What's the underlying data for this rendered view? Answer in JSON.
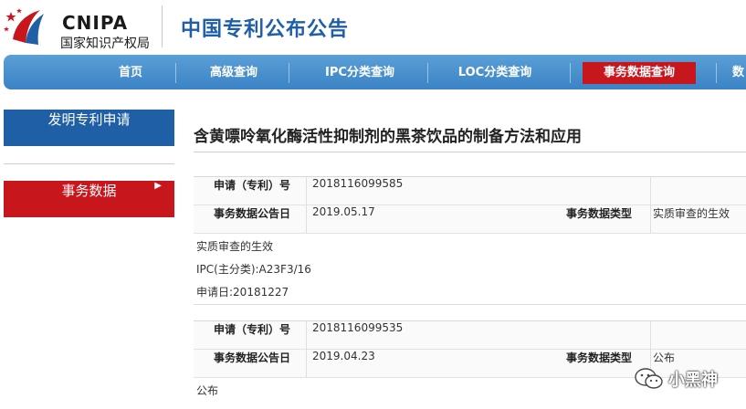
{
  "header": {
    "logo_en": "CNIPA",
    "logo_cn": "国家知识产权局",
    "site_title": "中国专利公布公告"
  },
  "nav": {
    "items": [
      "首页",
      "高级查询",
      "IPC分类查询",
      "LOC分类查询",
      "事务数据查询",
      "数"
    ],
    "active_index": 4
  },
  "sidebar": {
    "items": [
      {
        "label": "发明专利申请"
      },
      {
        "label": "事务数据",
        "arrow": "▶"
      }
    ]
  },
  "main": {
    "title": "含黄嘌呤氧化酶活性抑制剂的黑茶饮品的制备方法和应用"
  },
  "records": [
    {
      "app_no_label": "申请（专利）号",
      "app_no": "2018116099585",
      "date_label": "事务数据公告日",
      "date": "2019.05.17",
      "type_label": "事务数据类型",
      "type": "实质审查的生效",
      "details": [
        "实质审查的生效",
        "IPC(主分类):A23F3/16",
        "申请日:20181227"
      ]
    },
    {
      "app_no_label": "申请（专利）号",
      "app_no": "2018116099535",
      "date_label": "事务数据公告日",
      "date": "2019.04.23",
      "type_label": "事务数据类型",
      "type": "公布",
      "details": [
        "公布"
      ]
    }
  ],
  "watermark": {
    "text": "小黑神",
    "icon": "wechat-icon"
  },
  "colors": {
    "nav_blue": "#3a83c5",
    "accent_red": "#c8161d",
    "sidebar_blue": "#1f5fa6",
    "title_blue": "#1f5ea8"
  }
}
